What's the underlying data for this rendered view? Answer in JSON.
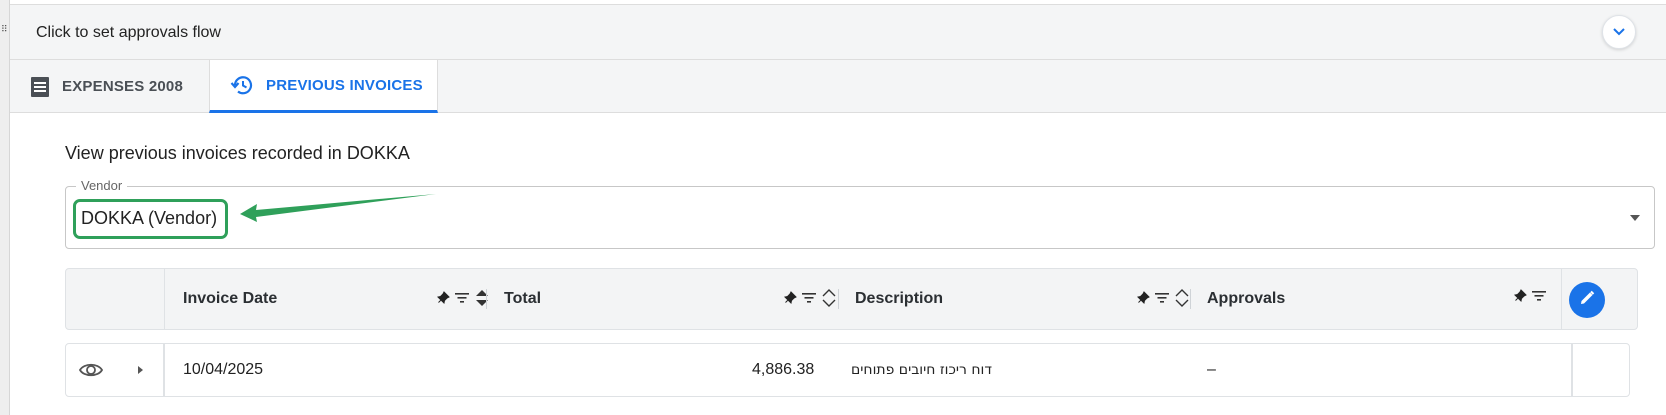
{
  "approvals_bar": {
    "text": "Click to set approvals flow"
  },
  "tabs": [
    {
      "label": "EXPENSES 2008",
      "icon": "list-icon",
      "active": false
    },
    {
      "label": "PREVIOUS INVOICES",
      "icon": "history-icon",
      "active": true
    }
  ],
  "view_text": "View previous invoices recorded in DOKKA",
  "vendor": {
    "legend": "Vendor",
    "value": "DOKKA (Vendor)"
  },
  "grid": {
    "columns": [
      "Invoice Date",
      "Total",
      "Description",
      "Approvals"
    ],
    "rows": [
      {
        "invoice_date": "10/04/2025",
        "total": "4,886.38",
        "description": "דוח ריכוז חיובים פתוחים",
        "approvals": "–"
      }
    ]
  },
  "colors": {
    "accent": "#1a73e8",
    "highlight": "#2fa05a"
  }
}
